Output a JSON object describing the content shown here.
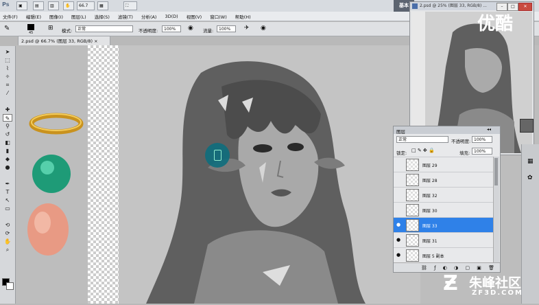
{
  "titlebar": {
    "logo": "Ps",
    "zoom": "66.7",
    "workspace": "基本"
  },
  "menu": [
    "文件(F)",
    "编辑(E)",
    "图像(I)",
    "图层(L)",
    "选择(S)",
    "滤镜(T)",
    "分析(A)",
    "3D(D)",
    "视图(V)",
    "窗口(W)",
    "帮助(H)"
  ],
  "options": {
    "brush_size": "45",
    "mode_label": "模式:",
    "mode_value": "正常",
    "opacity_label": "不透明度:",
    "opacity_value": "100%",
    "flow_label": "流量:",
    "flow_value": "100%"
  },
  "document_tab": "2.psd @ 66.7% (图层 33, RGB/8) ×",
  "navigator_title": "2.psd @ 25% (图层 33, RGB/8) ...",
  "layers_panel": {
    "title": "图层",
    "blend_mode": "正常",
    "opacity_label": "不透明度:",
    "opacity_value": "100%",
    "lock_label": "锁定:",
    "fill_label": "填充:",
    "fill_value": "100%",
    "layers": [
      {
        "name": "图层 29",
        "visible": false,
        "selected": false
      },
      {
        "name": "图层 28",
        "visible": false,
        "selected": false
      },
      {
        "name": "图层 32",
        "visible": false,
        "selected": false
      },
      {
        "name": "图层 30",
        "visible": false,
        "selected": false
      },
      {
        "name": "图层 33",
        "visible": true,
        "selected": true
      },
      {
        "name": "图层 31",
        "visible": true,
        "selected": false
      },
      {
        "name": "图层 5 副本",
        "visible": true,
        "selected": false
      }
    ]
  },
  "watermarks": {
    "youku": "优酷",
    "zf3d_cn": "朱峰社区",
    "zf3d_url": "ZF3D.COM"
  },
  "colors": {
    "selection": "#2f81e8",
    "ring_gold": "#c9921e",
    "sphere_green": "#1e9b77",
    "egg_peach": "#e89a84",
    "cursor_teal": "#0f6e7e"
  }
}
